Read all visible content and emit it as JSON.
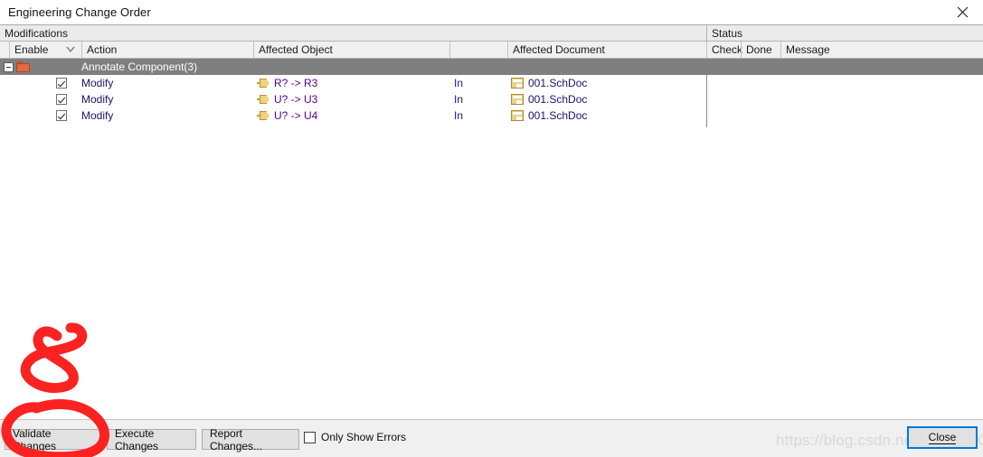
{
  "window": {
    "title": "Engineering Change Order",
    "close_icon": "close-x-icon"
  },
  "grid": {
    "group_headers": [
      {
        "label": "Modifications"
      },
      {
        "label": "Status"
      }
    ],
    "columns": [
      {
        "key": "spacer",
        "label": ""
      },
      {
        "key": "enable",
        "label": "Enable",
        "sort": "descending"
      },
      {
        "key": "action",
        "label": "Action"
      },
      {
        "key": "affected_object",
        "label": "Affected Object"
      },
      {
        "key": "in",
        "label": ""
      },
      {
        "key": "affected_document",
        "label": "Affected Document"
      },
      {
        "key": "check",
        "label": "Check"
      },
      {
        "key": "done",
        "label": "Done"
      },
      {
        "key": "message",
        "label": "Message"
      }
    ],
    "group_row": {
      "label": "Annotate Component(3)",
      "expander": "collapse-icon",
      "icon": "folder-icon",
      "expanded": true
    },
    "rows": [
      {
        "enabled": true,
        "action": "Modify",
        "affected_object": "R? -> R3",
        "object_icon": "component-icon",
        "relation": "In",
        "affected_document": "001.SchDoc",
        "document_icon": "document-icon",
        "check": "",
        "done": "",
        "message": ""
      },
      {
        "enabled": true,
        "action": "Modify",
        "affected_object": "U? -> U3",
        "object_icon": "component-icon",
        "relation": "In",
        "affected_document": "001.SchDoc",
        "document_icon": "document-icon",
        "check": "",
        "done": "",
        "message": ""
      },
      {
        "enabled": true,
        "action": "Modify",
        "affected_object": "U? -> U4",
        "object_icon": "component-icon",
        "relation": "In",
        "affected_document": "001.SchDoc",
        "document_icon": "document-icon",
        "check": "",
        "done": "",
        "message": ""
      }
    ]
  },
  "footer": {
    "validate_label": "Validate Changes",
    "execute_label": "Execute Changes",
    "report_label": "Report Changes...",
    "only_show_errors_label": "Only Show Errors",
    "only_show_errors_checked": false,
    "close_label": "Close"
  },
  "watermark": {
    "text": "https://blog.csdn.net/XL_MAX"
  },
  "annotations": {
    "ink_color": "#fb2222",
    "marks": [
      "hand-drawn-ampersand",
      "oval-around-validate-changes"
    ]
  },
  "colors": {
    "group_row_bg": "#7f7f7f",
    "header_bg": "#f1f0f0",
    "purple_text": "#55008f",
    "focus_blue": "#0078d7",
    "folder_orange": "#e06a42"
  }
}
